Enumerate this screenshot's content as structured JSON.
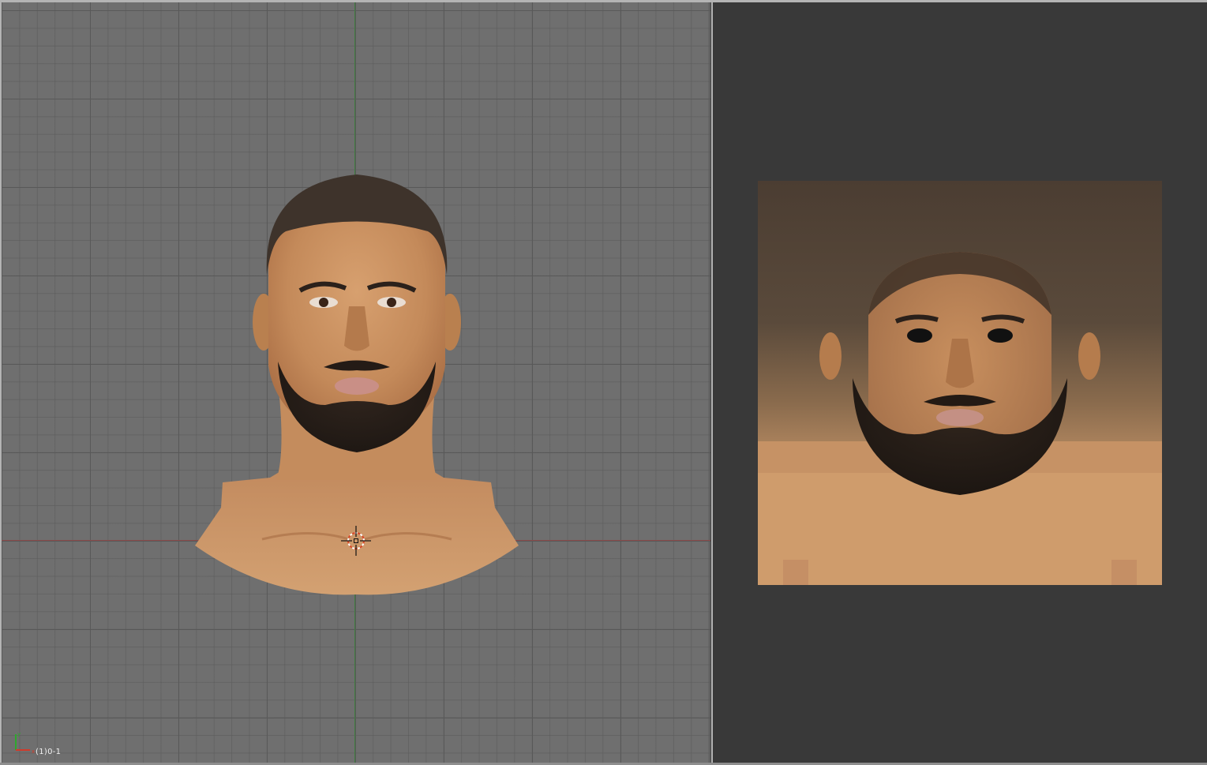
{
  "viewport": {
    "frame_label": "(1)0-1",
    "grid_color": "#6f6f6f",
    "x_axis_color": "#8a4a4a",
    "y_axis_color": "#3f7f3f",
    "object": "head-mesh",
    "gizmo_icon": "axes-gizmo-icon",
    "cursor_icon": "3d-cursor-icon"
  },
  "image_editor": {
    "background_color": "#393939",
    "image": "uv-face-texture"
  }
}
